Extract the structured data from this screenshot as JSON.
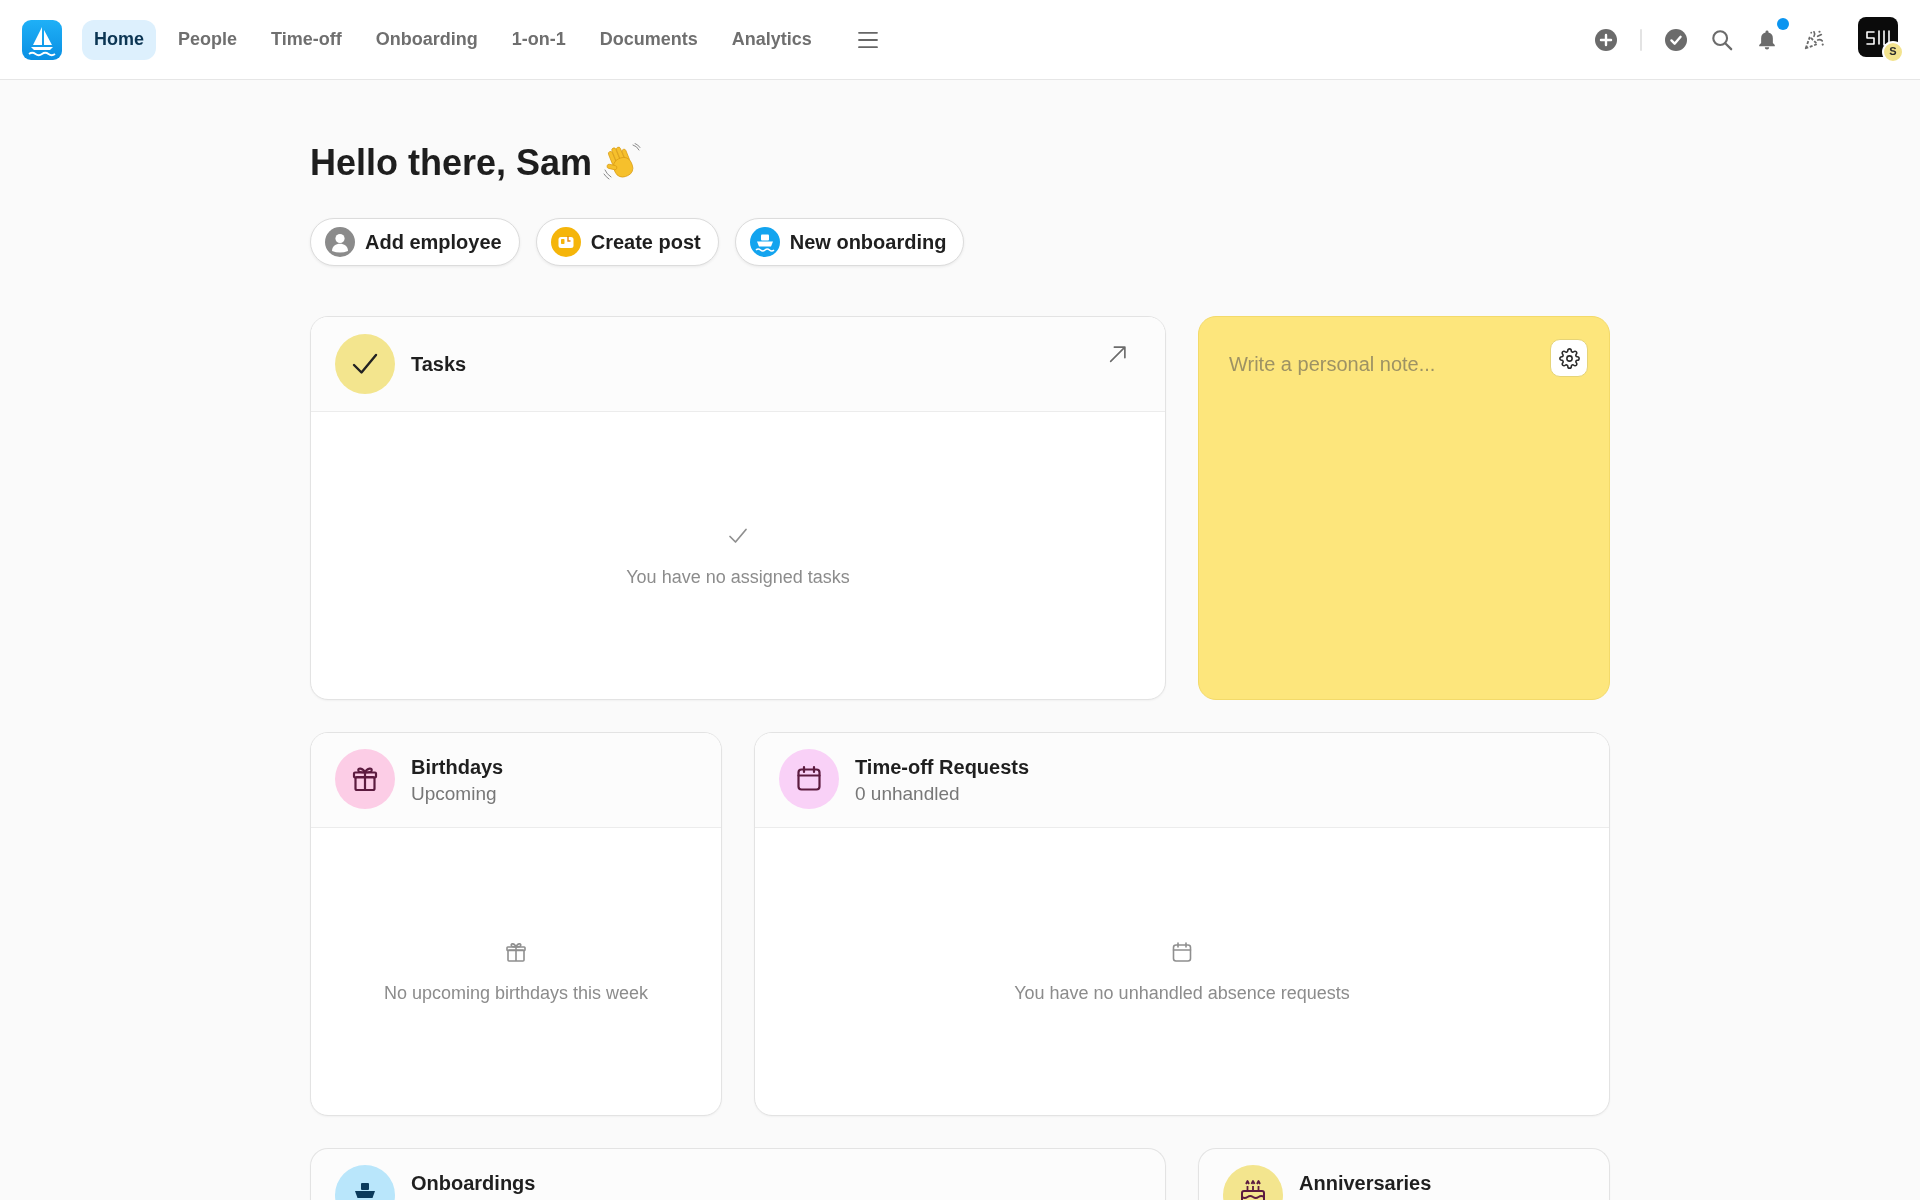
{
  "nav": {
    "items": [
      {
        "label": "Home",
        "selected": true
      },
      {
        "label": "People",
        "selected": false
      },
      {
        "label": "Time-off",
        "selected": false
      },
      {
        "label": "Onboarding",
        "selected": false
      },
      {
        "label": "1-on-1",
        "selected": false
      },
      {
        "label": "Documents",
        "selected": false
      },
      {
        "label": "Analytics",
        "selected": false
      }
    ]
  },
  "notifications": {
    "unread": true
  },
  "user": {
    "badge": "S"
  },
  "greeting": "Hello there, Sam",
  "quick_actions": [
    {
      "kind": "employee",
      "label": "Add employee"
    },
    {
      "kind": "post",
      "label": "Create post"
    },
    {
      "kind": "onboarding",
      "label": "New onboarding"
    }
  ],
  "cards": [
    {
      "kind": "tasks",
      "title": "Tasks",
      "empty_text": "You have no assigned tasks"
    },
    {
      "kind": "note",
      "placeholder": "Write a personal note..."
    },
    {
      "kind": "birthdays",
      "title": "Birthdays",
      "subtitle": "Upcoming",
      "empty_text": "No upcoming birthdays this week"
    },
    {
      "kind": "time_off",
      "title": "Time-off Requests",
      "subtitle": "0 unhandled",
      "empty_text": "You have no unhandled absence requests"
    },
    {
      "kind": "onboardings",
      "title": "Onboardings"
    },
    {
      "kind": "anniversaries",
      "title": "Anniversaries"
    }
  ]
}
